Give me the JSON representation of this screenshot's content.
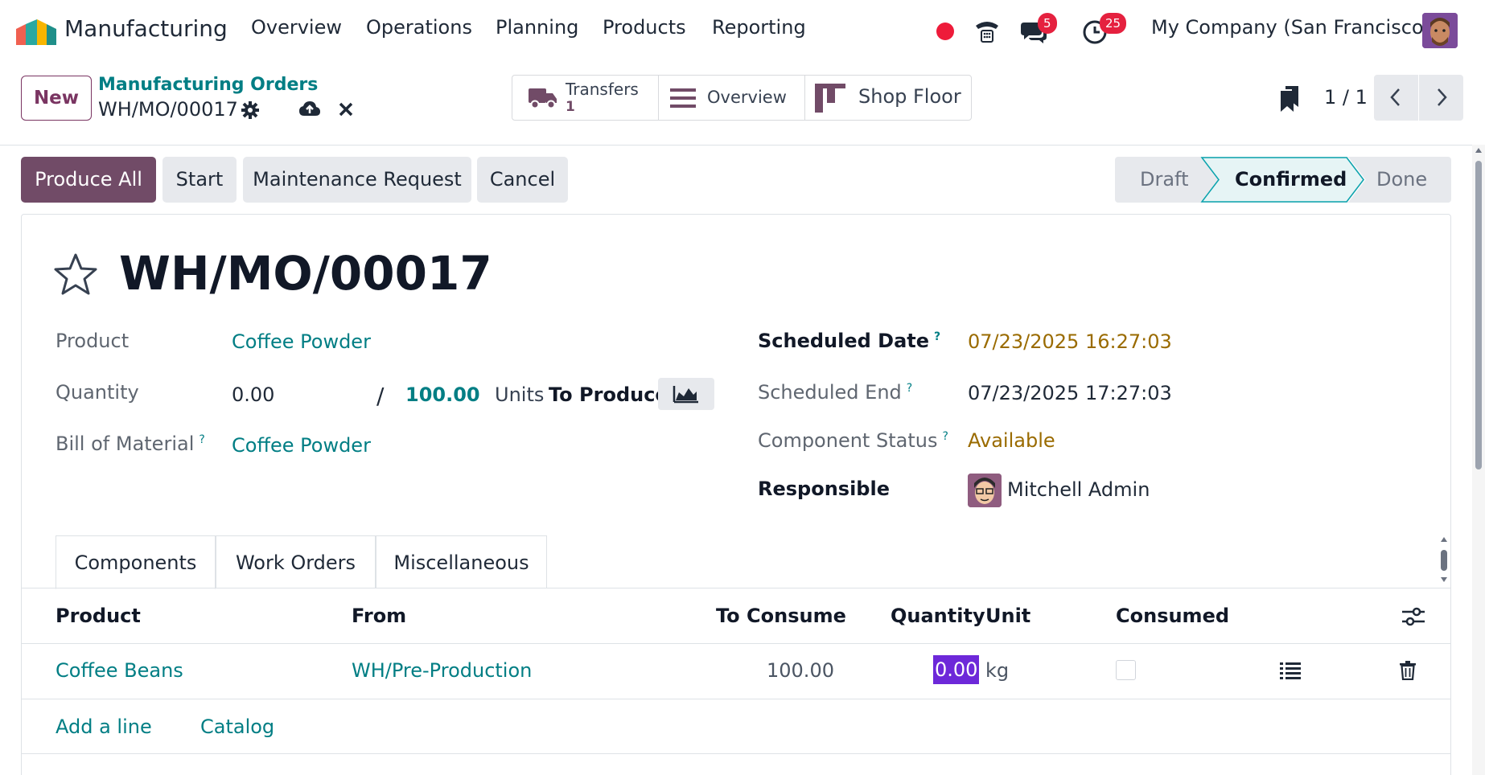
{
  "topnav": {
    "app_name": "Manufacturing",
    "menu": [
      "Overview",
      "Operations",
      "Planning",
      "Products",
      "Reporting"
    ],
    "messages_count": "5",
    "activities_count": "25",
    "company": "My Company (San Francisco)"
  },
  "control": {
    "new_label": "New",
    "breadcrumb_parent": "Manufacturing Orders",
    "breadcrumb_current": "WH/MO/00017",
    "transfers_label": "Transfers",
    "transfers_count": "1",
    "overview_label": "Overview",
    "shop_floor_label": "Shop Floor",
    "pager": "1 / 1"
  },
  "actions": {
    "produce_all": "Produce All",
    "start": "Start",
    "maintenance": "Maintenance Request",
    "cancel": "Cancel"
  },
  "statusbar": {
    "stages": [
      "Draft",
      "Confirmed",
      "Done"
    ],
    "active": "Confirmed"
  },
  "form": {
    "title": "WH/MO/00017",
    "product_label": "Product",
    "product_value": "Coffee Powder",
    "quantity_label": "Quantity",
    "quantity_value": "0.00",
    "quantity_sep": "/",
    "quantity_target": "100.00",
    "quantity_unit": "Units",
    "quantity_suffix": "To Produce",
    "bom_label": "Bill of Material",
    "bom_value": "Coffee Powder",
    "scheduled_date_label": "Scheduled Date",
    "scheduled_date_value": "07/23/2025 16:27:03",
    "scheduled_end_label": "Scheduled End",
    "scheduled_end_value": "07/23/2025 17:27:03",
    "component_status_label": "Component Status",
    "component_status_value": "Available",
    "responsible_label": "Responsible",
    "responsible_value": "Mitchell Admin",
    "help_mark": "?"
  },
  "tabs": [
    "Components",
    "Work Orders",
    "Miscellaneous"
  ],
  "components_table": {
    "headers": [
      "Product",
      "From",
      "To Consume",
      "Quantity",
      "Unit",
      "Consumed"
    ],
    "rows": [
      {
        "product": "Coffee Beans",
        "from": "WH/Pre-Production",
        "to_consume": "100.00",
        "quantity": "0.00",
        "unit": "kg",
        "consumed": false
      }
    ],
    "add_line": "Add a line",
    "catalog": "Catalog"
  },
  "colors": {
    "primary": "#714b67",
    "link": "#017e84",
    "warning_text": "#9a6b00",
    "badge": "#e5213f",
    "status_active_bg": "#e6f4f5",
    "status_active_border": "#0aa3ad",
    "selection": "#6d28d9"
  }
}
